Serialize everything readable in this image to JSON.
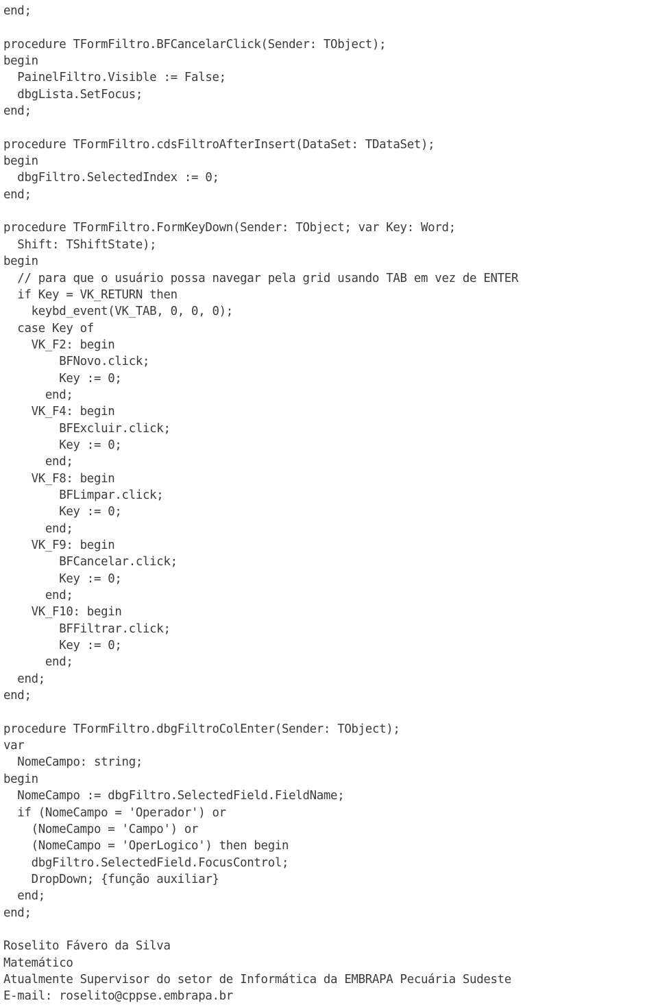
{
  "document": {
    "kind": "source-code-listing",
    "language": "Object Pascal (Delphi)",
    "background_color": "#ffffff",
    "text_color": "#3b3b3b"
  },
  "code": {
    "lines": [
      "end;",
      "",
      "procedure TFormFiltro.BFCancelarClick(Sender: TObject);",
      "begin",
      "  PainelFiltro.Visible := False;",
      "  dbgLista.SetFocus;",
      "end;",
      "",
      "procedure TFormFiltro.cdsFiltroAfterInsert(DataSet: TDataSet);",
      "begin",
      "  dbgFiltro.SelectedIndex := 0;",
      "end;",
      "",
      "procedure TFormFiltro.FormKeyDown(Sender: TObject; var Key: Word;",
      "  Shift: TShiftState);",
      "begin",
      "  // para que o usuário possa navegar pela grid usando TAB em vez de ENTER",
      "  if Key = VK_RETURN then",
      "    keybd_event(VK_TAB, 0, 0, 0);",
      "  case Key of",
      "    VK_F2: begin",
      "        BFNovo.click;",
      "        Key := 0;",
      "      end;",
      "    VK_F4: begin",
      "        BFExcluir.click;",
      "        Key := 0;",
      "      end;",
      "    VK_F8: begin",
      "        BFLimpar.click;",
      "        Key := 0;",
      "      end;",
      "    VK_F9: begin",
      "        BFCancelar.click;",
      "        Key := 0;",
      "      end;",
      "    VK_F10: begin",
      "        BFFiltrar.click;",
      "        Key := 0;",
      "      end;",
      "  end;",
      "end;",
      "",
      "procedure TFormFiltro.dbgFiltroColEnter(Sender: TObject);",
      "var",
      "  NomeCampo: string;",
      "begin",
      "  NomeCampo := dbgFiltro.SelectedField.FieldName;",
      "  if (NomeCampo = 'Operador') or",
      "    (NomeCampo = 'Campo') or",
      "    (NomeCampo = 'OperLogico') then begin",
      "    dbgFiltro.SelectedField.FocusControl;",
      "    DropDown; {função auxiliar}",
      "  end;",
      "end;"
    ]
  },
  "footer": {
    "lines": [
      "",
      "Roselito Fávero da Silva",
      "Matemático",
      "Atualmente Supervisor do setor de Informática da EMBRAPA Pecuária Sudeste",
      "E-mail: roselito@cppse.embrapa.br"
    ],
    "author_name": "Roselito Fávero da Silva",
    "author_title": "Matemático",
    "author_role": "Atualmente Supervisor do setor de Informática da EMBRAPA Pecuária Sudeste",
    "author_email_line": "E-mail: roselito@cppse.embrapa.br",
    "author_email": "roselito@cppse.embrapa.br"
  }
}
